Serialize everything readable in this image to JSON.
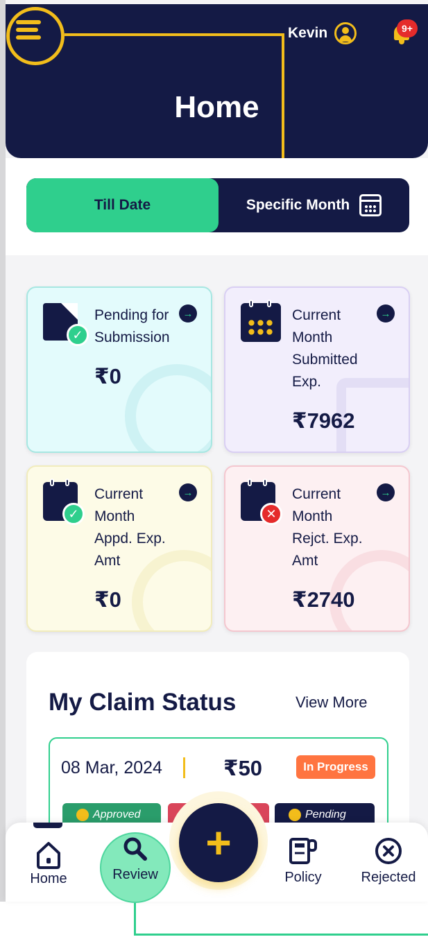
{
  "header": {
    "user_name": "Kevin",
    "notification_count": "9+",
    "title": "Home"
  },
  "toggle": {
    "active_label": "Till Date",
    "inactive_label": "Specific Month"
  },
  "cards": [
    {
      "label_lines": [
        "Pending for",
        "Submission"
      ],
      "value": "₹0",
      "icon": "pending-document-icon",
      "color": "#e3fbfc"
    },
    {
      "label_lines": [
        "Current",
        "Month",
        "Submitted",
        "Exp."
      ],
      "value": "₹7962",
      "icon": "calendar-icon",
      "color": "#f2eefc"
    },
    {
      "label_lines": [
        "Current",
        "Month",
        "Appd. Exp.",
        "Amt"
      ],
      "value": "₹0",
      "icon": "calendar-check-icon",
      "color": "#fdfbe7"
    },
    {
      "label_lines": [
        "Current",
        "Month",
        "Rejct. Exp.",
        "Amt"
      ],
      "value": "₹2740",
      "icon": "calendar-cross-icon",
      "color": "#fdf0f2"
    }
  ],
  "claims": {
    "title": "My Claim Status",
    "view_more": "View More",
    "item": {
      "date": "08 Mar, 2024",
      "amount": "₹50",
      "status": "In Progress",
      "chips": [
        "Approved",
        "Pending"
      ]
    }
  },
  "nav": {
    "home": "Home",
    "review": "Review",
    "add": "+",
    "policy": "Policy",
    "rejected": "Rejected"
  },
  "colors": {
    "navy": "#141a45",
    "accent_yellow": "#f2bd1b",
    "accent_green": "#2fcf8d",
    "status_orange": "#ff7440",
    "notification_red": "#e52b2b"
  }
}
